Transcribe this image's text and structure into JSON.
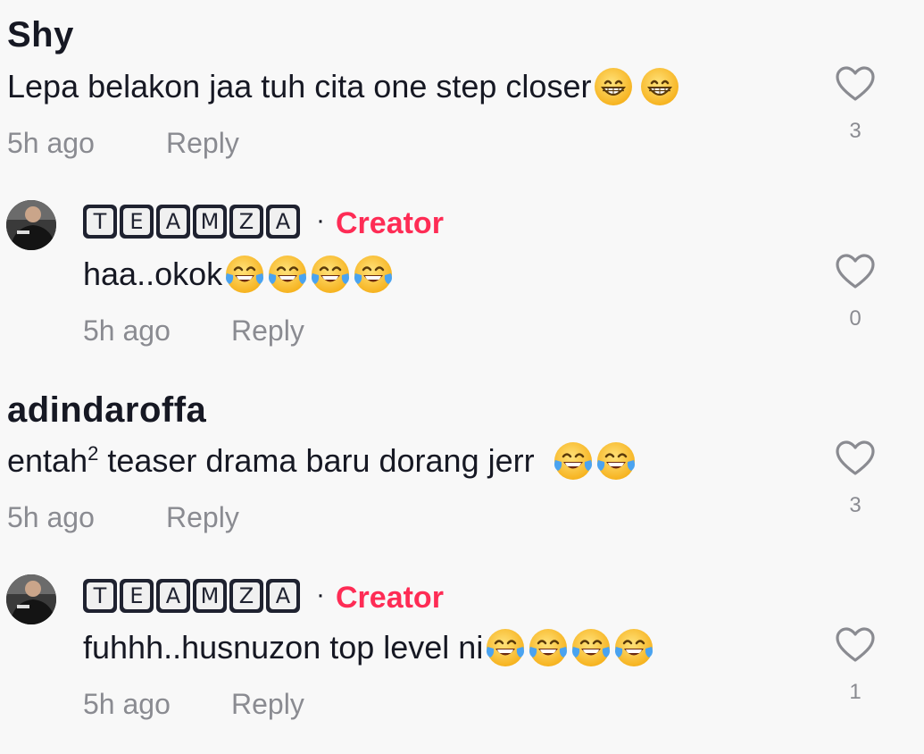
{
  "comments": [
    {
      "username": "Shy",
      "text": "Lepa belakon jaa tuh cita one step closer",
      "emojis": [
        "grin-emoji",
        "grin-emoji"
      ],
      "time": "5h ago",
      "reply_label": "Reply",
      "likes": "3"
    },
    {
      "username_letters": [
        "T",
        "E",
        "A",
        "M",
        "Z",
        "A"
      ],
      "dot": "·",
      "badge": "Creator",
      "text": "haa..okok",
      "emojis": [
        "tears-of-joy-emoji",
        "tears-of-joy-emoji",
        "tears-of-joy-emoji",
        "tears-of-joy-emoji"
      ],
      "time": "5h ago",
      "reply_label": "Reply",
      "likes": "0"
    },
    {
      "username": "adindaroffa",
      "text_before": "entah",
      "text_sup": "2",
      "text_after": " teaser drama baru dorang jerr ",
      "emojis": [
        "tears-of-joy-emoji",
        "tears-of-joy-emoji"
      ],
      "time": "5h ago",
      "reply_label": "Reply",
      "likes": "3"
    },
    {
      "username_letters": [
        "T",
        "E",
        "A",
        "M",
        "Z",
        "A"
      ],
      "dot": "·",
      "badge": "Creator",
      "text": "fuhhh..husnuzon top level ni",
      "emojis": [
        "tears-of-joy-emoji",
        "tears-of-joy-emoji",
        "tears-of-joy-emoji",
        "tears-of-joy-emoji"
      ],
      "time": "5h ago",
      "reply_label": "Reply",
      "likes": "1"
    }
  ],
  "colors": {
    "background": "#f8f8f8",
    "text": "#161823",
    "muted": "#8a8b91",
    "creator_badge": "#fe2c55",
    "emoji_face": "#fbc531"
  },
  "icons": {
    "like": "heart-outline-icon",
    "avatar": "teamza-avatar"
  }
}
